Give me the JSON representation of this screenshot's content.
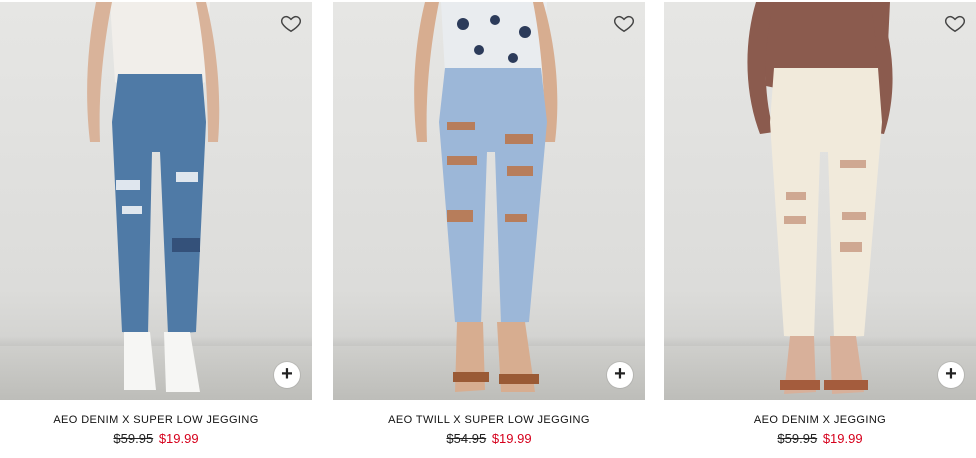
{
  "products": [
    {
      "name": "AEO DENIM X SUPER LOW JEGGING",
      "was_price": "$59.95",
      "sale_price": "$19.99",
      "jean_color": "#4f7aa6",
      "top_color": "#f1eeea",
      "shoe_color": "#f6f6f4",
      "icons": {
        "favorite": "heart-outline-icon",
        "add": "plus-icon"
      }
    },
    {
      "name": "AEO TWILL X SUPER LOW JEGGING",
      "was_price": "$54.95",
      "sale_price": "$19.99",
      "jean_color": "#9cb7d8",
      "top_color": "#e9ecef",
      "shoe_color": "#9a5a35",
      "icons": {
        "favorite": "heart-outline-icon",
        "add": "plus-icon"
      }
    },
    {
      "name": "AEO DENIM X JEGGING",
      "was_price": "$59.95",
      "sale_price": "$19.99",
      "jean_color": "#f1eadb",
      "top_color": "#8b5b4e",
      "shoe_color": "#a45c3d",
      "icons": {
        "favorite": "heart-outline-icon",
        "add": "plus-icon"
      }
    }
  ],
  "colors": {
    "sale": "#d6001c",
    "text": "#111111"
  }
}
